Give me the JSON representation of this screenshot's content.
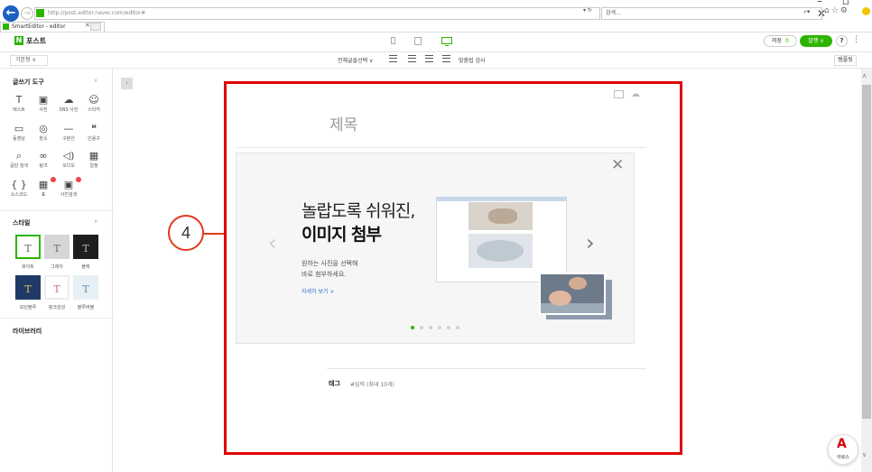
{
  "browser": {
    "url": "http://post.editor.naver.com/editor#",
    "search_placeholder": "검색...",
    "tab_title": "SmartEditor - editor",
    "window_controls": "– ▫ ✕"
  },
  "header": {
    "logo_letter": "N",
    "logo_text": "포스트",
    "save_label": "저장",
    "save_count": "0",
    "publish_label": "발행 ∨",
    "help_label": "?",
    "more_label": "⋮"
  },
  "toolbar": {
    "style_select": "기본형  ∨",
    "font_select": "전체글꼴선택  ∨",
    "spell_check": "맞춤법 검사",
    "template_label": "템플릿"
  },
  "sidebar": {
    "writing_tools_title": "글쓰기 도구",
    "tools": [
      {
        "label": "텍스트",
        "glyph": "T"
      },
      {
        "label": "사진",
        "glyph": "▣"
      },
      {
        "label": "SNS 사진",
        "glyph": "☁"
      },
      {
        "label": "스티커",
        "glyph": "☺"
      },
      {
        "label": "동영상",
        "glyph": "▭"
      },
      {
        "label": "장소",
        "glyph": "◎"
      },
      {
        "label": "구분선",
        "glyph": "—"
      },
      {
        "label": "인용구",
        "glyph": "❝"
      },
      {
        "label": "글감 검색",
        "glyph": "⌕"
      },
      {
        "label": "링크",
        "glyph": "∞"
      },
      {
        "label": "오디오",
        "glyph": "◁)"
      },
      {
        "label": "일정",
        "glyph": "▦"
      },
      {
        "label": "소스코드",
        "glyph": "{ }"
      },
      {
        "label": "표",
        "glyph": "▦"
      },
      {
        "label": "사진검색",
        "glyph": "▣"
      }
    ],
    "style_title": "스타일",
    "styles": [
      {
        "label": "화이트",
        "glyph": "T",
        "bg": "#ffffff",
        "fg": "#666666",
        "border": "#2db400"
      },
      {
        "label": "그레이",
        "glyph": "T",
        "bg": "#d6d6d6",
        "fg": "#666666",
        "border": "#d6d6d6"
      },
      {
        "label": "블랙",
        "glyph": "T",
        "bg": "#1e1e1e",
        "fg": "#bbbbbb",
        "border": "#1e1e1e"
      },
      {
        "label": "모던블루",
        "glyph": "T",
        "bg": "#1f3a66",
        "fg": "#e8c15a",
        "border": "#1f3a66"
      },
      {
        "label": "핑크감성",
        "glyph": "T",
        "bg": "#ffffff",
        "fg": "#d0677a",
        "border": "#eeeeee"
      },
      {
        "label": "블루버블",
        "glyph": "T",
        "bg": "#e6f0f5",
        "fg": "#5a8fb0",
        "border": "#e6f0f5"
      }
    ],
    "library_title": "라이브러리"
  },
  "editor": {
    "title_placeholder": "제목",
    "card": {
      "headline_1": "놀랍도록 쉬워진,",
      "headline_2": "이미지 첨부",
      "desc_1": "원하는 사진을 선택해",
      "desc_2": "바로 첨부하세요.",
      "more_link": "자세히 보기 >",
      "total_slides": 6,
      "active_slide": 1
    },
    "tag_label": "태그",
    "tag_placeholder": "#입력 (최대 10개)"
  },
  "annotation": {
    "number": "4",
    "color": "#e00000"
  },
  "fab_label": "아로스"
}
